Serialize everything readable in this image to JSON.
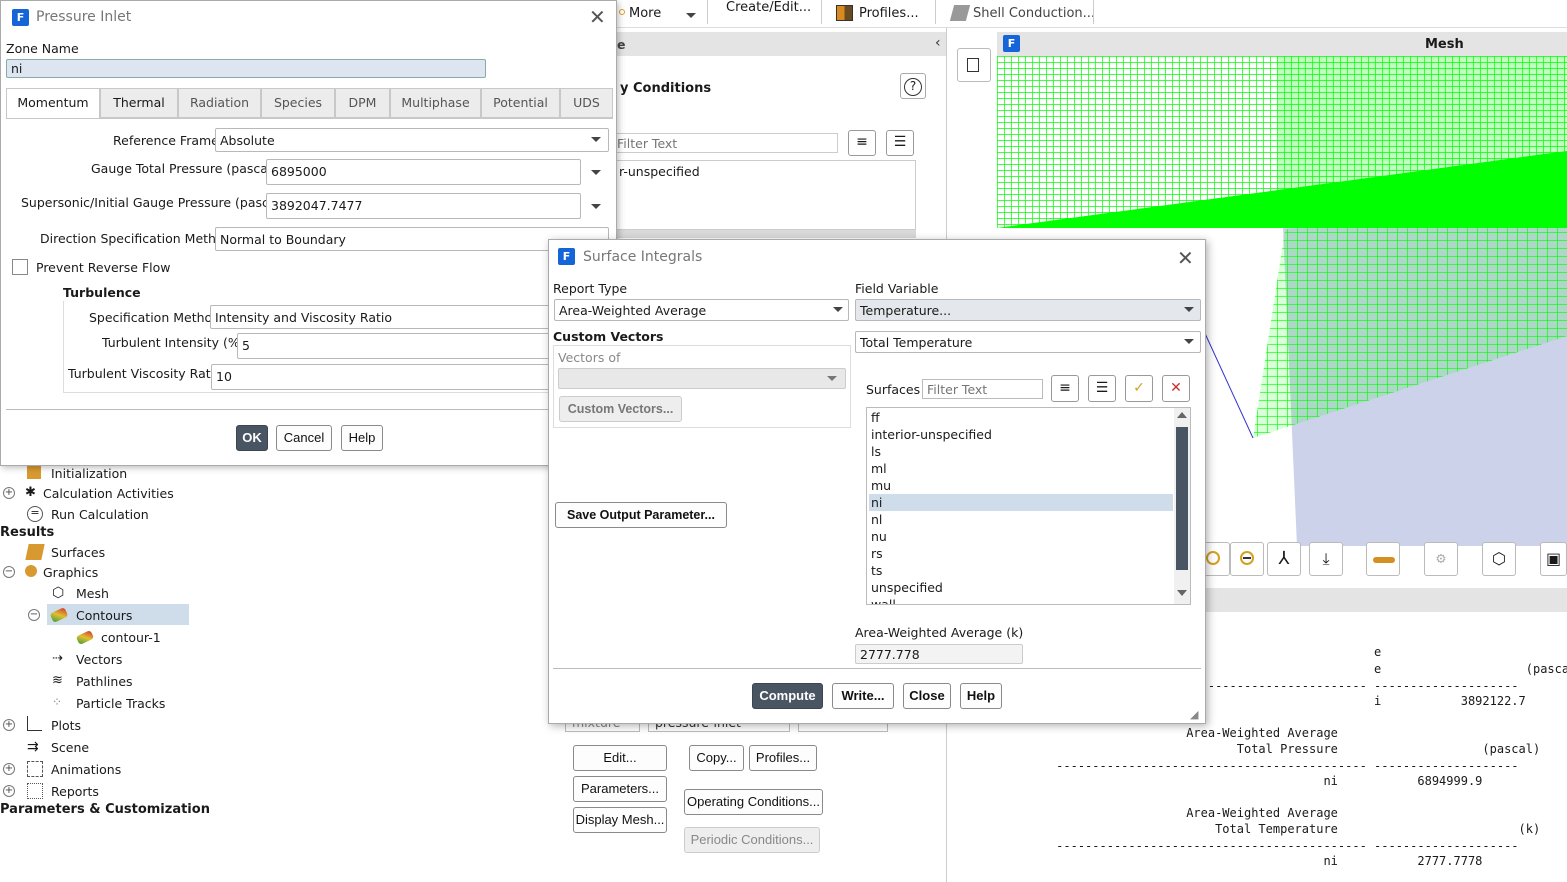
{
  "toolbar": {
    "more": "More",
    "create_edit": "Create/Edit...",
    "profiles": "Profiles...",
    "shell_conduction": "Shell Conduction..."
  },
  "bc_panel": {
    "title_fragment": "e",
    "heading_fragment": "y Conditions",
    "filter_placeholder": "Filter Text",
    "zone_list_item": "r-unspecified",
    "mixture_label": "mixture",
    "type_value": "pressure-inlet",
    "buttons": {
      "edit": "Edit...",
      "copy": "Copy...",
      "profiles": "Profiles...",
      "parameters": "Parameters...",
      "operating_conditions": "Operating Conditions...",
      "display_mesh": "Display Mesh...",
      "periodic_conditions": "Periodic Conditions..."
    }
  },
  "graphics": {
    "title": "Mesh"
  },
  "console": {
    "lines": [
      "                                                          e",
      "                                                          e                    (pascal)",
      "              ------------------------------------------- --------------------",
      "                                                          i           3892122.7",
      "",
      "                                Area-Weighted Average",
      "                                       Total Pressure                    (pascal)",
      "              ------------------------------------------- --------------------",
      "                                                   ni           6894999.9",
      "",
      "                                Area-Weighted Average",
      "                                    Total Temperature                         (k)",
      "              ------------------------------------------- --------------------",
      "                                                   ni           2777.7778"
    ]
  },
  "tree": {
    "items": [
      {
        "label": "Initialization"
      },
      {
        "label": "Calculation Activities"
      },
      {
        "label": "Run Calculation"
      },
      {
        "label": "Results"
      },
      {
        "label": "Surfaces"
      },
      {
        "label": "Graphics"
      },
      {
        "label": "Mesh"
      },
      {
        "label": "Contours"
      },
      {
        "label": "contour-1"
      },
      {
        "label": "Vectors"
      },
      {
        "label": "Pathlines"
      },
      {
        "label": "Particle Tracks"
      },
      {
        "label": "Plots"
      },
      {
        "label": "Scene"
      },
      {
        "label": "Animations"
      },
      {
        "label": "Reports"
      },
      {
        "label": "Parameters & Customization"
      }
    ]
  },
  "pressure_inlet": {
    "title": "Pressure Inlet",
    "zone_name_label": "Zone Name",
    "zone_name_value": "ni",
    "tabs": [
      "Momentum",
      "Thermal",
      "Radiation",
      "Species",
      "DPM",
      "Multiphase",
      "Potential",
      "UDS"
    ],
    "reference_frame_label": "Reference Frame",
    "reference_frame_value": "Absolute",
    "gauge_total_pressure_label": "Gauge Total Pressure (pascal)",
    "gauge_total_pressure_value": "6895000",
    "supersonic_label": "Supersonic/Initial Gauge Pressure (pascal)",
    "supersonic_value": "3892047.7477",
    "direction_label": "Direction Specification Method",
    "direction_value": "Normal to Boundary",
    "prevent_reverse_flow": "Prevent Reverse Flow",
    "turbulence_heading": "Turbulence",
    "spec_method_label": "Specification Method",
    "spec_method_value": "Intensity and Viscosity Ratio",
    "turb_intensity_label": "Turbulent Intensity (%)",
    "turb_intensity_value": "5",
    "turb_visc_label": "Turbulent Viscosity Ratio",
    "turb_visc_value": "10",
    "ok": "OK",
    "cancel": "Cancel",
    "help": "Help"
  },
  "surface_integrals": {
    "title": "Surface Integrals",
    "report_type_label": "Report Type",
    "report_type_value": "Area-Weighted Average",
    "field_variable_label": "Field Variable",
    "field_variable_value": "Temperature...",
    "field_sub_value": "Total Temperature",
    "custom_vectors_heading": "Custom Vectors",
    "vectors_of_label": "Vectors of",
    "custom_vectors_button": "Custom Vectors...",
    "surfaces_label": "Surfaces",
    "surfaces_filter_placeholder": "Filter Text",
    "surfaces": [
      "ff",
      "interior-unspecified",
      "ls",
      "ml",
      "mu",
      "ni",
      "nl",
      "nu",
      "rs",
      "ts",
      "unspecified",
      "wall"
    ],
    "selected_surface": "ni",
    "save_output_parameter": "Save Output Parameter...",
    "result_label": "Area-Weighted Average (k)",
    "result_value": "2777.778",
    "compute": "Compute",
    "write": "Write...",
    "close": "Close",
    "help": "Help"
  },
  "colors": {
    "accent": "#1565d8",
    "mesh_green": "#00ff00",
    "selection": "#cfdcea"
  }
}
